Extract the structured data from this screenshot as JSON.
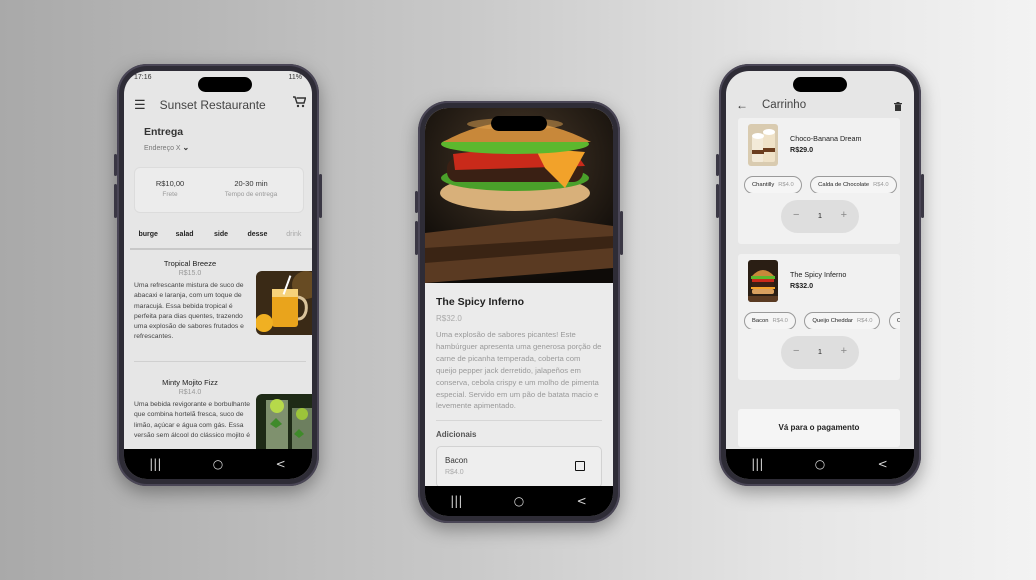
{
  "phone1": {
    "status_time": "17:16",
    "status_right": "11%",
    "app_title": "Sunset Restaurante",
    "delivery_title": "Entrega",
    "address": "Endereço X",
    "fee_value": "R$10,00",
    "fee_label": "Frete",
    "time_value": "20-30 min",
    "time_label": "Tempo de entrega",
    "tabs": [
      "burge",
      "salad",
      "side",
      "desse",
      "drink"
    ],
    "items": [
      {
        "name": "Tropical Breeze",
        "price": "R$15.0",
        "description": "Uma refrescante mistura de suco de abacaxi e laranja, com um toque de maracujá. Essa bebida tropical é perfeita para dias quentes, trazendo uma explosão de sabores frutados e refrescantes."
      },
      {
        "name": "Minty Mojito Fizz",
        "price": "R$14.0",
        "description": "Uma bebida revigorante e borbulhante que combina hortelã fresca, suco de limão, açúcar e água com gás. Essa versão sem álcool do clássico mojito é"
      }
    ]
  },
  "phone2": {
    "item_title": "The Spicy Inferno",
    "item_price": "R$32.0",
    "item_description": "Uma explosão de sabores picantes! Este hambúrguer apresenta uma generosa porção de carne de picanha temperada, coberta com queijo pepper jack derretido, jalapeños em conserva, cebola crispy e um molho de pimenta especial. Servido em um pão de batata macio e levemente apimentado.",
    "addons_title": "Adicionais",
    "addon_name": "Bacon",
    "addon_price": "R$4.0"
  },
  "phone3": {
    "title": "Carrinho",
    "items": [
      {
        "name": "Choco-Banana Dream",
        "price": "R$29.0",
        "chips": [
          {
            "label": "Chantilly",
            "price": "R$4.0"
          },
          {
            "label": "Calda de Chocolate",
            "price": "R$4.0"
          }
        ],
        "qty": "1"
      },
      {
        "name": "The Spicy Inferno",
        "price": "R$32.0",
        "chips": [
          {
            "label": "Bacon",
            "price": "R$4.0"
          },
          {
            "label": "Queijo Cheddar",
            "price": "R$4.0"
          },
          {
            "label": "Ce",
            "price": ""
          }
        ],
        "qty": "1"
      }
    ],
    "pay_label": "Vá para o pagamento"
  },
  "navbar": {
    "recent": "|||",
    "home": "○",
    "back": "<"
  },
  "colors": {
    "background_left": "#a9a9a9",
    "background_right": "#f3f3f3",
    "phone_frame": "#2e2c36",
    "screen": "#e6e6e6"
  }
}
